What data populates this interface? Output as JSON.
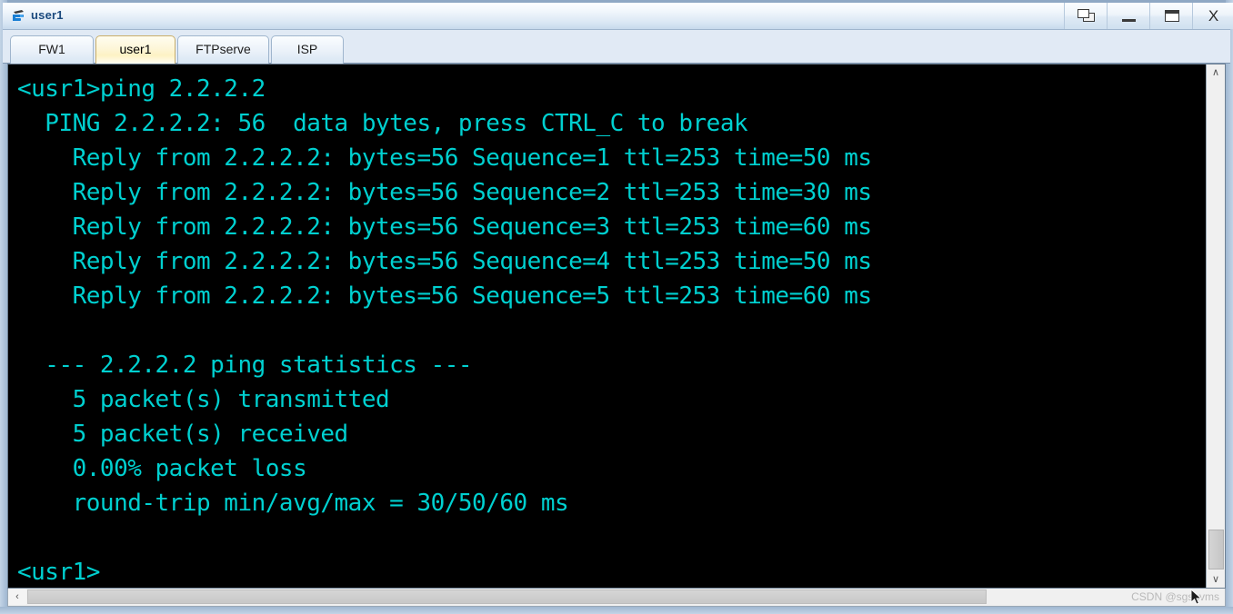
{
  "window": {
    "title": "user1",
    "icon": "device-icon",
    "controls": [
      {
        "name": "restore-button",
        "label": "❐",
        "icon": "restore-icon"
      },
      {
        "name": "minimize-button",
        "label": "–",
        "icon": "minimize-icon"
      },
      {
        "name": "maximize-button",
        "label": "☐",
        "icon": "maximize-icon"
      },
      {
        "name": "close-button",
        "label": "X",
        "icon": "close-icon"
      }
    ]
  },
  "tabs": [
    {
      "label": "FW1",
      "active": false
    },
    {
      "label": "user1",
      "active": true
    },
    {
      "label": "FTPserve",
      "active": false
    },
    {
      "label": "ISP",
      "active": false
    }
  ],
  "terminal": {
    "foreground_color": "#00d0d0",
    "background_color": "#000000",
    "lines": [
      "<usr1>ping 2.2.2.2",
      "  PING 2.2.2.2: 56  data bytes, press CTRL_C to break",
      "    Reply from 2.2.2.2: bytes=56 Sequence=1 ttl=253 time=50 ms",
      "    Reply from 2.2.2.2: bytes=56 Sequence=2 ttl=253 time=30 ms",
      "    Reply from 2.2.2.2: bytes=56 Sequence=3 ttl=253 time=60 ms",
      "    Reply from 2.2.2.2: bytes=56 Sequence=4 ttl=253 time=50 ms",
      "    Reply from 2.2.2.2: bytes=56 Sequence=5 ttl=253 time=60 ms",
      "",
      "  --- 2.2.2.2 ping statistics ---",
      "    5 packet(s) transmitted",
      "    5 packet(s) received",
      "    0.00% packet loss",
      "    round-trip min/avg/max = 30/50/60 ms",
      "",
      "<usr1>"
    ]
  },
  "scrollbars": {
    "vertical": {
      "up_label": "∧",
      "down_label": "∨"
    },
    "horizontal": {
      "left_label": "‹"
    }
  },
  "watermark": {
    "text": "CSDN @sgshvms"
  }
}
